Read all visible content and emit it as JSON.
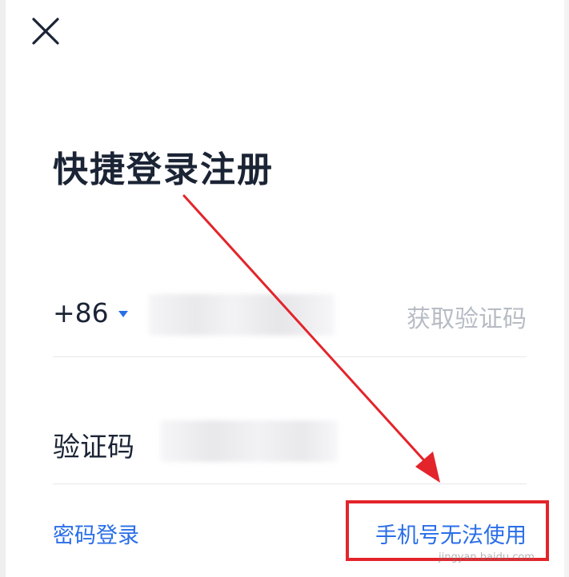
{
  "header": {
    "close_icon": "close-icon"
  },
  "page": {
    "title": "快捷登录注册"
  },
  "phone_row": {
    "country_code": "+86",
    "caret_icon": "caret-down-icon",
    "phone_value": "",
    "get_code_label": "获取验证码"
  },
  "code_row": {
    "label": "验证码",
    "code_value": ""
  },
  "footer": {
    "password_login": "密码登录",
    "phone_unavailable": "手机号无法使用"
  },
  "annotation": {
    "watermark": "jingyan.baidu.com",
    "highlight_color": "#e3242b"
  },
  "colors": {
    "accent": "#2a6ee8",
    "title_text": "#1b2435",
    "muted_text": "#b7bcc4",
    "divider": "#e6e8ec",
    "annotation_red": "#e3242b"
  }
}
